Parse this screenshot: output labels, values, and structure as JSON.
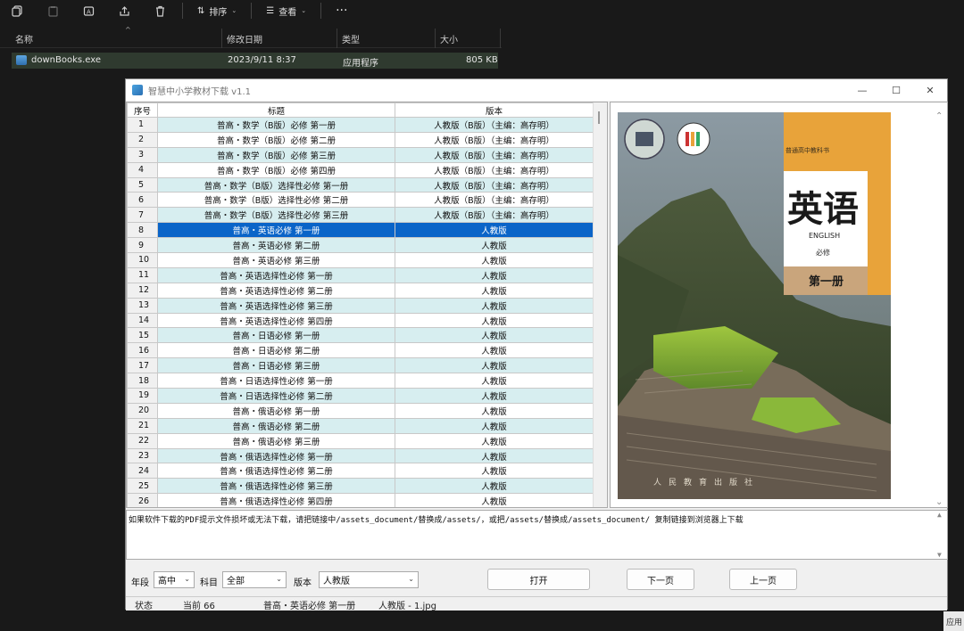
{
  "explorer": {
    "toolbar": {
      "sort_label": "排序",
      "view_label": "查看"
    },
    "columns": {
      "name": "名称",
      "modified": "修改日期",
      "type": "类型",
      "size": "大小"
    },
    "file": {
      "name": "downBooks.exe",
      "modified": "2023/9/11 8:37",
      "type": "应用程序",
      "size": "805 KB"
    }
  },
  "app": {
    "title": "智慧中小学教材下载 v1.1",
    "table": {
      "headers": [
        "序号",
        "标题",
        "版本"
      ],
      "selected_index": 7,
      "rows": [
        {
          "n": "1",
          "title": "普高・数学（B版）必修 第一册",
          "edition": "人教版（B版）（主编：高存明）"
        },
        {
          "n": "2",
          "title": "普高・数学（B版）必修 第二册",
          "edition": "人教版（B版）（主编：高存明）"
        },
        {
          "n": "3",
          "title": "普高・数学（B版）必修 第三册",
          "edition": "人教版（B版）（主编：高存明）"
        },
        {
          "n": "4",
          "title": "普高・数学（B版）必修 第四册",
          "edition": "人教版（B版）（主编：高存明）"
        },
        {
          "n": "5",
          "title": "普高・数学（B版）选择性必修 第一册",
          "edition": "人教版（B版）（主编：高存明）"
        },
        {
          "n": "6",
          "title": "普高・数学（B版）选择性必修 第二册",
          "edition": "人教版（B版）（主编：高存明）"
        },
        {
          "n": "7",
          "title": "普高・数学（B版）选择性必修 第三册",
          "edition": "人教版（B版）（主编：高存明）"
        },
        {
          "n": "8",
          "title": "普高・英语必修 第一册",
          "edition": "人教版"
        },
        {
          "n": "9",
          "title": "普高・英语必修 第二册",
          "edition": "人教版"
        },
        {
          "n": "10",
          "title": "普高・英语必修 第三册",
          "edition": "人教版"
        },
        {
          "n": "11",
          "title": "普高・英语选择性必修 第一册",
          "edition": "人教版"
        },
        {
          "n": "12",
          "title": "普高・英语选择性必修 第二册",
          "edition": "人教版"
        },
        {
          "n": "13",
          "title": "普高・英语选择性必修 第三册",
          "edition": "人教版"
        },
        {
          "n": "14",
          "title": "普高・英语选择性必修 第四册",
          "edition": "人教版"
        },
        {
          "n": "15",
          "title": "普高・日语必修 第一册",
          "edition": "人教版"
        },
        {
          "n": "16",
          "title": "普高・日语必修 第二册",
          "edition": "人教版"
        },
        {
          "n": "17",
          "title": "普高・日语必修 第三册",
          "edition": "人教版"
        },
        {
          "n": "18",
          "title": "普高・日语选择性必修 第一册",
          "edition": "人教版"
        },
        {
          "n": "19",
          "title": "普高・日语选择性必修 第二册",
          "edition": "人教版"
        },
        {
          "n": "20",
          "title": "普高・俄语必修 第一册",
          "edition": "人教版"
        },
        {
          "n": "21",
          "title": "普高・俄语必修 第二册",
          "edition": "人教版"
        },
        {
          "n": "22",
          "title": "普高・俄语必修 第三册",
          "edition": "人教版"
        },
        {
          "n": "23",
          "title": "普高・俄语选择性必修 第一册",
          "edition": "人教版"
        },
        {
          "n": "24",
          "title": "普高・俄语选择性必修 第二册",
          "edition": "人教版"
        },
        {
          "n": "25",
          "title": "普高・俄语选择性必修 第三册",
          "edition": "人教版"
        },
        {
          "n": "26",
          "title": "普高・俄语选择性必修 第四册",
          "edition": "人教版"
        }
      ]
    },
    "cover": {
      "series": "普通高中教科书",
      "title": "英语",
      "subtitle": "ENGLISH",
      "type": "必修",
      "volume": "第一册",
      "publisher": "人民教育出版社"
    },
    "message": "如果软件下载的PDF提示文件损坏或无法下载，请把链接中/assets_document/替换成/assets/，或把/assets/替换成/assets_document/ 复制链接到浏览器上下载",
    "controls": {
      "grade_label": "年段",
      "grade_value": "高中",
      "subject_label": "科目",
      "subject_value": "全部",
      "edition_label": "版本",
      "edition_value": "人教版",
      "open_button": "打开",
      "next_button": "下一页",
      "prev_button": "上一页"
    },
    "status": {
      "label": "状态",
      "current": "当前 66",
      "book": "普高・英语必修 第一册",
      "file": "人教版 - 1.jpg"
    }
  },
  "corner_label": "应用"
}
